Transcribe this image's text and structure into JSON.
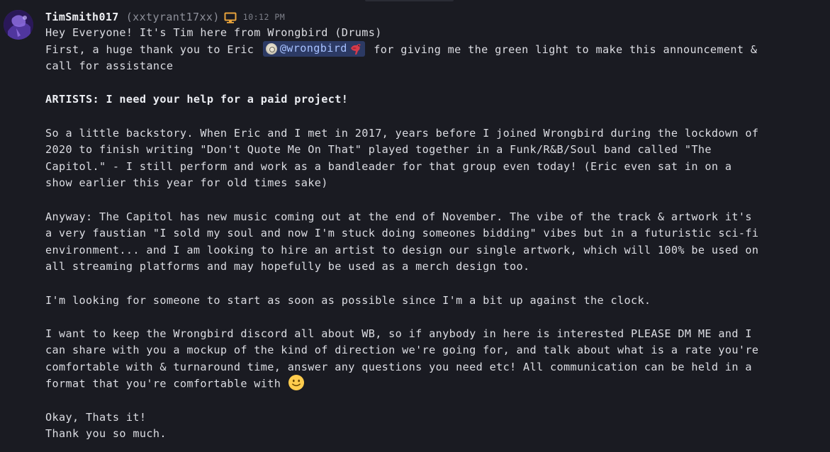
{
  "message": {
    "author": {
      "username": "TimSmith017",
      "alt_name": "(xxtyrant17xx)",
      "badge_icon": "monitor-icon"
    },
    "timestamp": "10:12 PM",
    "mention": {
      "handle": "@wrongbird",
      "trailing_icon": "red-bird-icon"
    },
    "lines": {
      "l1": "Hey Everyone! It's Tim here from Wrongbird (Drums)",
      "l2_before": "First, a huge thank you to Eric",
      "l2_after": "for giving me the green light to make this announcement &",
      "l3": "call for assistance",
      "l4": "ARTISTS: I need your help for a paid project!",
      "l5": "So a little backstory. When Eric and I met in 2017, years before I joined Wrongbird during the lockdown of",
      "l6": "2020 to finish writing \"Don't Quote Me On That\" played together in a Funk/R&B/Soul band called \"The",
      "l7": "Capitol.\" - I still perform and work as a bandleader for that group even today! (Eric even sat in on a",
      "l8": "show earlier this year for old times sake)",
      "l9": "Anyway: The Capitol has new music coming out at the end of November. The vibe of the track & artwork it's",
      "l10": "a very faustian \"I sold my soul and now I'm stuck doing someones bidding\" vibes but in a futuristic sci-fi",
      "l11": "environment... and I am looking to hire an artist to design our single artwork, which will 100% be used on",
      "l12": "all streaming platforms and may hopefully be used as a merch design too.",
      "l13": "I'm looking for someone to start as soon as possible since I'm a bit up against the clock.",
      "l14": "I want to keep the Wrongbird discord all about WB, so if anybody in here is interested PLEASE DM ME and I",
      "l15": "can share with you a mockup of the kind of direction we're going for, and talk about what is a rate you're",
      "l16": "comfortable with & turnaround time, answer any questions you need etc! All communication can be held in a",
      "l17": "format that you're comfortable with",
      "l18": "Okay, Thats it!",
      "l19": "Thank you so much."
    },
    "emoji": "slightly-smiling-face-icon"
  },
  "colors": {
    "background": "#1a1b22",
    "text": "#dcdde3",
    "mention_bg": "#2c3a64",
    "mention_text": "#a7c1ff",
    "timestamp": "#7e808a",
    "badge": "#e8a33c"
  }
}
